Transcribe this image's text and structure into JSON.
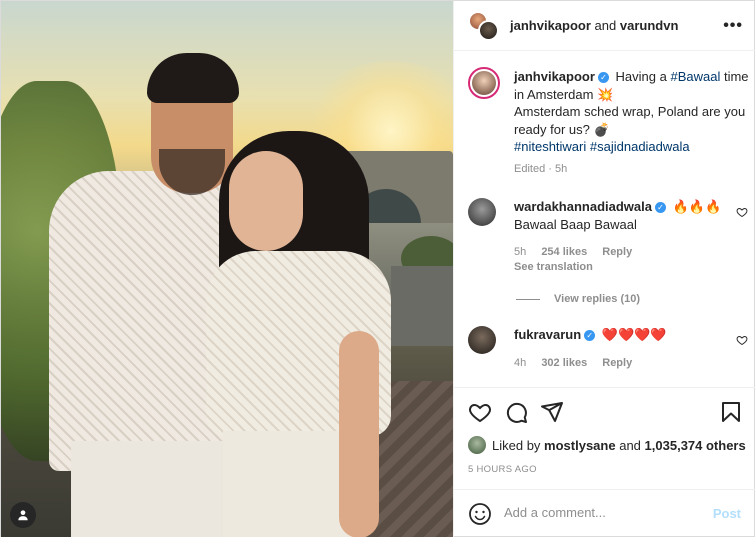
{
  "post": {
    "photo_alt": "",
    "header": {
      "user1": "janhvikapoor",
      "joiner": "and",
      "user2": "varundvn",
      "more": "•••"
    },
    "caption": {
      "username": "janhvikapoor",
      "verified": "✓",
      "line1_pre": "Having a ",
      "hashtag1": "#Bawaal",
      "line1_post": " time in Amsterdam 💥",
      "line2": "Amsterdam sched wrap, Poland are you ready for us? 💣",
      "hashtag2": "#niteshtiwari",
      "hashtag3": "#sajidnadiadwala",
      "edited": "Edited · 5h"
    },
    "comments": [
      {
        "username": "wardakhannadiadwala",
        "verified": "✓",
        "text_inline": "🔥🔥🔥",
        "text": "Bawaal Baap Bawaal",
        "time": "5h",
        "likes": "254 likes",
        "reply": "Reply",
        "translate": "See translation",
        "view_replies": "View replies (10)"
      },
      {
        "username": "fukravarun",
        "verified": "✓",
        "text_inline": "❤️❤️❤️❤️",
        "time": "4h",
        "likes": "302 likes",
        "reply": "Reply"
      }
    ],
    "actions": {
      "like": "heart-icon",
      "comment": "comment-icon",
      "share": "share-icon",
      "save": "bookmark-icon"
    },
    "liked_by": {
      "prefix": "Liked by ",
      "user": "mostlysane",
      "middle": " and ",
      "count": "1,035,374 others"
    },
    "time_ago": "5 HOURS AGO",
    "add_comment": {
      "placeholder": "Add a comment...",
      "post": "Post"
    }
  }
}
